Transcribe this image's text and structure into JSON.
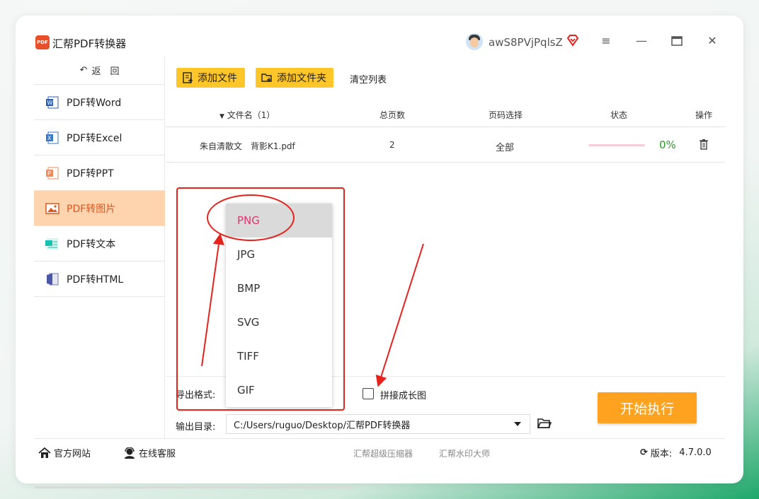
{
  "window": {
    "title": "汇帮PDF转换器",
    "logo_text": "PDF",
    "username": "awS8PVjPqlsZ"
  },
  "sidebar": {
    "back_label": "返　回",
    "items": [
      {
        "label": "PDF转Word",
        "icon": "word-icon"
      },
      {
        "label": "PDF转Excel",
        "icon": "excel-icon"
      },
      {
        "label": "PDF转PPT",
        "icon": "ppt-icon"
      },
      {
        "label": "PDF转图片",
        "icon": "image-icon",
        "active": true
      },
      {
        "label": "PDF转文本",
        "icon": "text-icon"
      },
      {
        "label": "PDF转HTML",
        "icon": "html-icon"
      }
    ]
  },
  "toolbar": {
    "add_file": "添加文件",
    "add_folder": "添加文件夹",
    "clear_list": "清空列表"
  },
  "table": {
    "headers": {
      "filename": "文件名（1）",
      "pages": "总页数",
      "page_select": "页码选择",
      "status": "状态",
      "action": "操作"
    },
    "rows": [
      {
        "filename": "朱自清散文　背影K1.pdf",
        "pages": "2",
        "page_select": "全部",
        "progress": 0,
        "progress_text": "0%"
      }
    ]
  },
  "export_format": {
    "label": "导出格式:",
    "selected": "PNG",
    "options": [
      "PNG",
      "JPG",
      "BMP",
      "SVG",
      "TIFF",
      "GIF"
    ]
  },
  "stitch": {
    "label": "拼接成长图",
    "checked": false
  },
  "start_button": "开始执行",
  "output": {
    "label": "输出目录:",
    "path": "C:/Users/ruguo/Desktop/汇帮PDF转换器"
  },
  "bottom_bar": {
    "website": "官方网站",
    "support": "在线客服",
    "compressor": "汇帮超级压缩器",
    "watermark": "汇帮水印大师",
    "version_label": "版本:",
    "version": "4.7.0.0"
  },
  "colors": {
    "accent": "#ffc629",
    "start": "#fea21f",
    "active_nav_bg": "#fdd4ae",
    "annotation": "#e5231c",
    "selected_option": "#e2336b"
  }
}
